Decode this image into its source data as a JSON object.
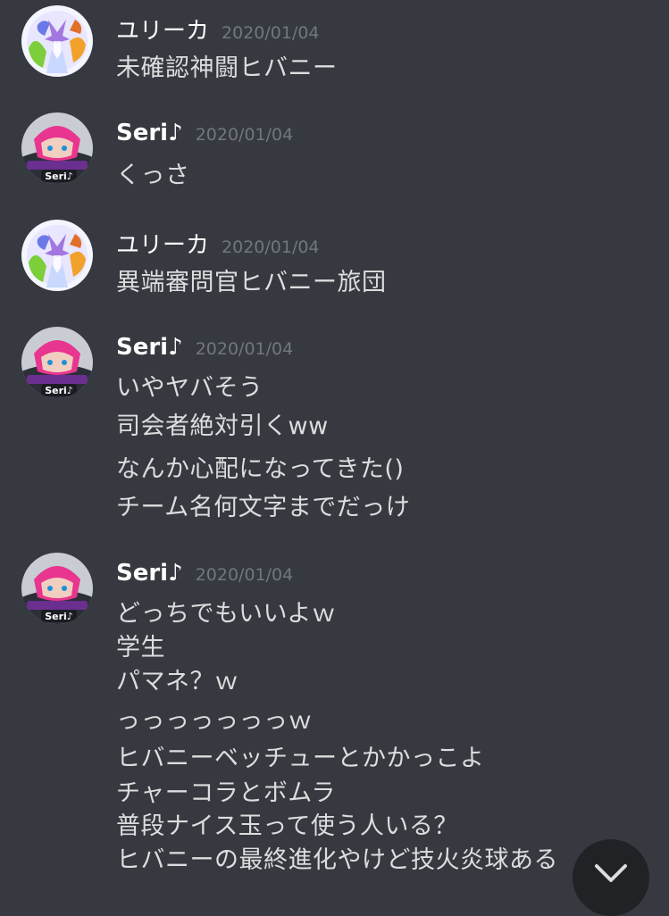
{
  "messages": [
    {
      "author": "ユリーカ",
      "timestamp": "2020/01/04",
      "lines": [
        "未確認神闘ヒバニー"
      ]
    },
    {
      "author": "Seri♪",
      "timestamp": "2020/01/04",
      "lines": [
        "くっさ"
      ]
    },
    {
      "author": "ユリーカ",
      "timestamp": "2020/01/04",
      "lines": [
        "異端審問官ヒバニー旅団"
      ]
    },
    {
      "author": "Seri♪",
      "timestamp": "2020/01/04",
      "lines": [
        "いやヤバそう",
        "司会者絶対引くww",
        "なんか心配になってきた()",
        "チーム名何文字までだっけ"
      ]
    },
    {
      "author": "Seri♪",
      "timestamp": "2020/01/04",
      "lines": [
        "どっちでもいいよｗ",
        "学生",
        "パマネ？ｗ",
        "っっっっっっっｗ",
        "ヒバニーベッチューとかかっこよ",
        "チャーコラとボムラ",
        "普段ナイス玉って使う人いる？",
        "ヒバニーの最終進化やけど技火炎球ある"
      ]
    }
  ],
  "avatar_label": "Seri♪",
  "scroll_button_icon": "chevron-down-icon",
  "colors": {
    "background": "#36393f",
    "text": "#dcddde",
    "username": "#ffffff",
    "timestamp": "#72767d",
    "scroll_button": "#202225"
  }
}
